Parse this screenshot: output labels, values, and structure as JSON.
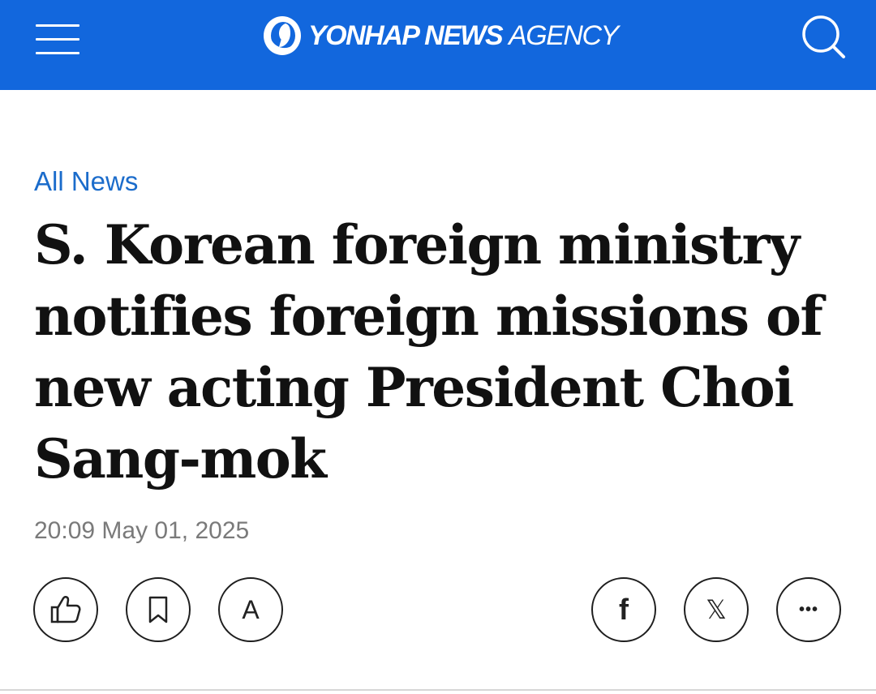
{
  "header": {
    "brand_bold": "YONHAP NEWS",
    "brand_light": "AGENCY",
    "menu_icon": "hamburger-menu-icon",
    "search_icon": "search-icon",
    "background_color": "#1267dd"
  },
  "article": {
    "category": "All News",
    "headline": "S. Korean foreign ministry notifies foreign missions of new acting President Choi Sang-mok",
    "timestamp": "20:09 May 01, 2025"
  },
  "actions": {
    "like_icon": "thumbs-up-icon",
    "bookmark_icon": "bookmark-icon",
    "font_size_label": "A",
    "facebook_label": "f",
    "x_label": "𝕏",
    "more_label": "•••"
  },
  "colors": {
    "accent": "#1267dd",
    "category_link": "#1b6ccb",
    "headline": "#111111",
    "timestamp": "#7a7a7a"
  }
}
